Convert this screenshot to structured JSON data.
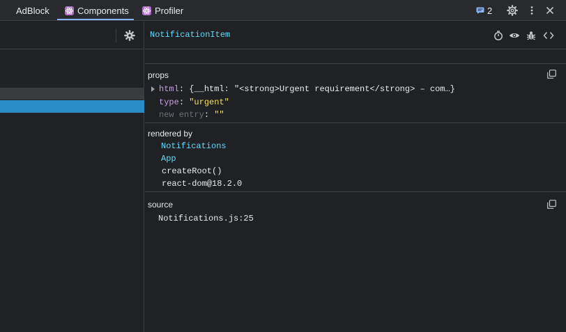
{
  "tabs": [
    {
      "label": "AdBlock",
      "icon": "none",
      "active": false
    },
    {
      "label": "Components",
      "icon": "react-icon",
      "active": true
    },
    {
      "label": "Profiler",
      "icon": "react-icon",
      "active": false
    }
  ],
  "toolbar": {
    "issues_count": "2",
    "issues_icon": "message-icon",
    "settings_icon": "gear-icon",
    "more_icon": "more-vert-icon",
    "close_icon": "close-icon"
  },
  "component": {
    "name": "NotificationItem",
    "header_icons": [
      "stopwatch-icon",
      "eye-icon",
      "bug-icon",
      "code-icon"
    ]
  },
  "props": {
    "title": "props",
    "rows": [
      {
        "key": "html",
        "value": "{__html: \"<strong>Urgent requirement</strong> – com…}",
        "expandable": true
      },
      {
        "key": "type",
        "value": "\"urgent\"",
        "expandable": false
      },
      {
        "key": "new entry",
        "value": "\"\"",
        "expandable": false,
        "placeholder": true
      }
    ]
  },
  "rendered_by": {
    "title": "rendered by",
    "owners": [
      {
        "label": "Notifications",
        "link": true
      },
      {
        "label": "App",
        "link": true
      },
      {
        "label": "createRoot()",
        "link": false
      },
      {
        "label": "react-dom@18.2.0",
        "link": false
      }
    ]
  },
  "source": {
    "title": "source",
    "location": "Notifications.js:25"
  },
  "colors": {
    "accent": "#8ab4f8",
    "react_blue": "#61dafb",
    "selection": "#2a8cc7",
    "prop_key": "#c79ee6",
    "string_value": "#f7e15a"
  }
}
